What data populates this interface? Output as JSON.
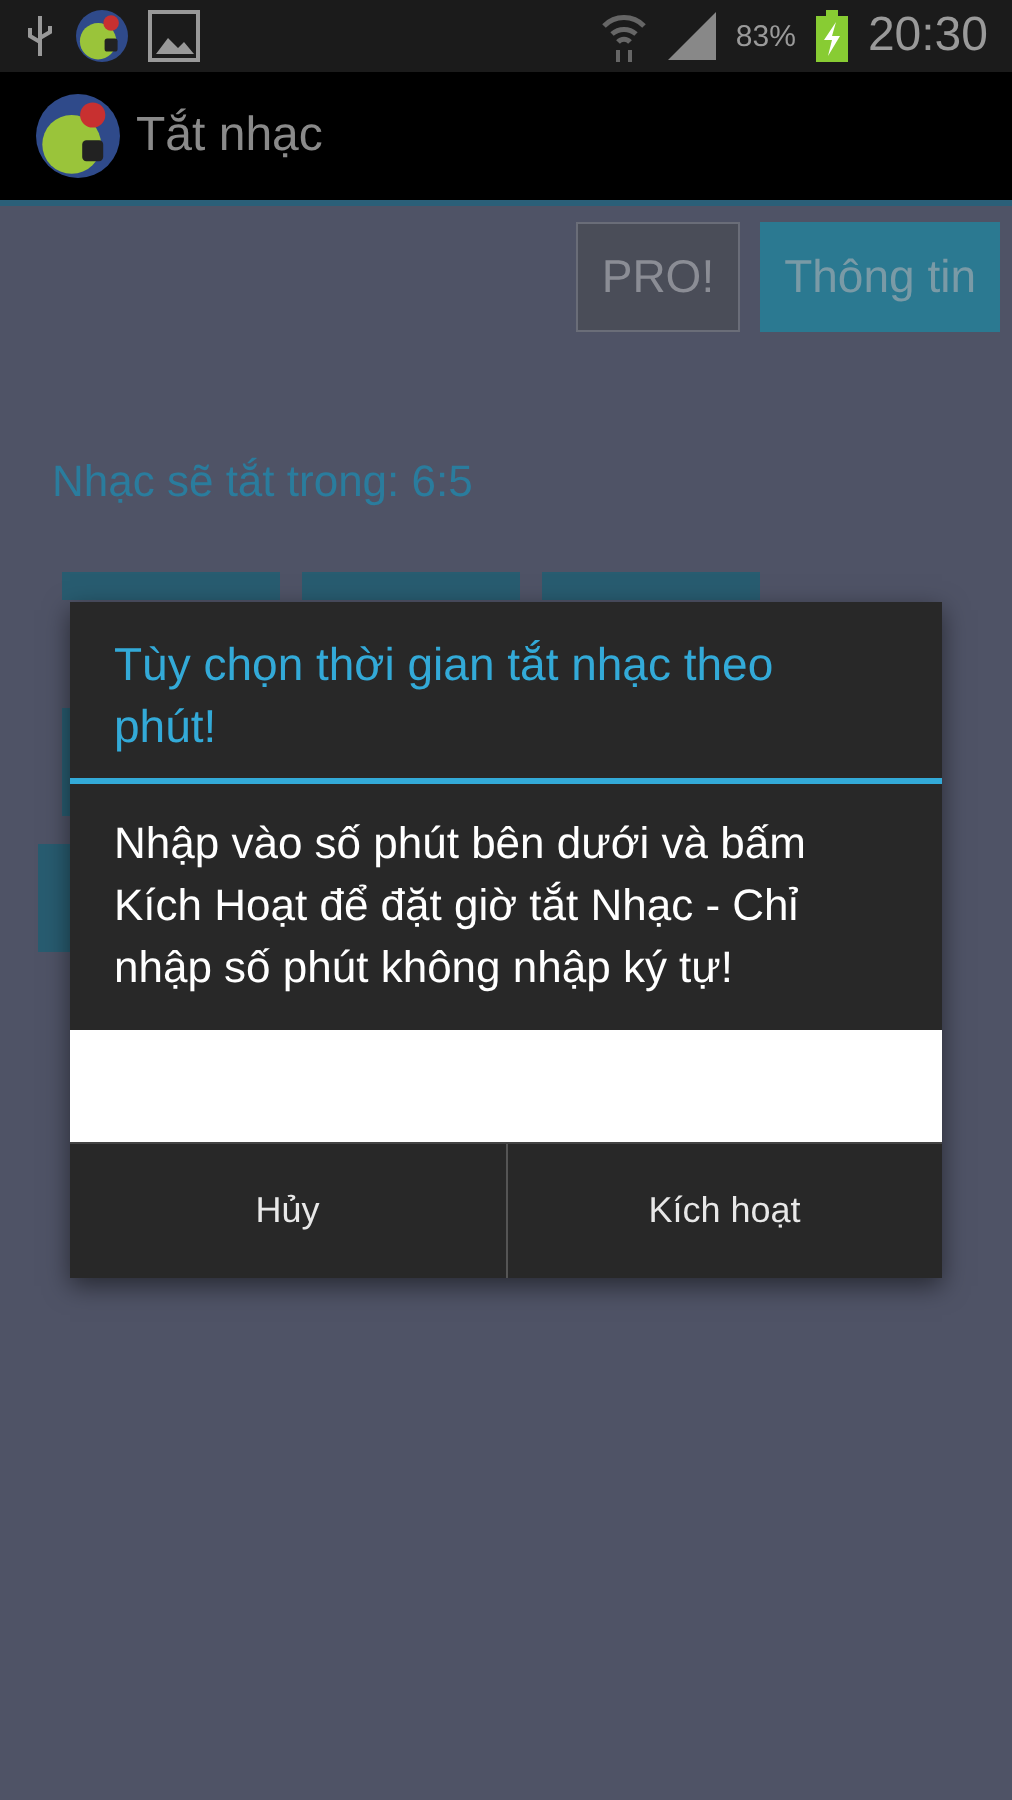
{
  "status_bar": {
    "battery": "83%",
    "time": "20:30"
  },
  "action_bar": {
    "title": "Tắt nhạc"
  },
  "top_buttons": [
    {
      "label": "PRO!",
      "kind": "plain"
    },
    {
      "label": "Thông tin",
      "kind": "accent"
    }
  ],
  "countdown": "Nhạc sẽ tắt trong: 6:5",
  "dialog": {
    "title": "Tùy chọn thời gian tắt nhạc theo phút!",
    "message": "Nhập vào số phút bên dưới và bấm Kích Hoạt để đặt giờ tắt Nhạc - Chỉ nhập số phút không nhập ký tự!",
    "buttons": [
      "Hủy",
      "Kích hoạt"
    ]
  }
}
